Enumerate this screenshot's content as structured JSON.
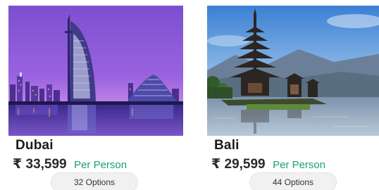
{
  "packages": [
    {
      "image": "dubai-skyline-photo",
      "destination": "Dubai",
      "price": "₹ 33,599",
      "price_suffix": "Per Person",
      "options": "32 Options"
    },
    {
      "image": "bali-temple-photo",
      "destination": "Bali",
      "price": "₹ 29,599",
      "price_suffix": "Per Person",
      "options": "44 Options"
    }
  ],
  "colors": {
    "accent_green": "#16a07a",
    "text_dark": "#1b1b1b",
    "pill_bg": "#f1f1f1"
  }
}
